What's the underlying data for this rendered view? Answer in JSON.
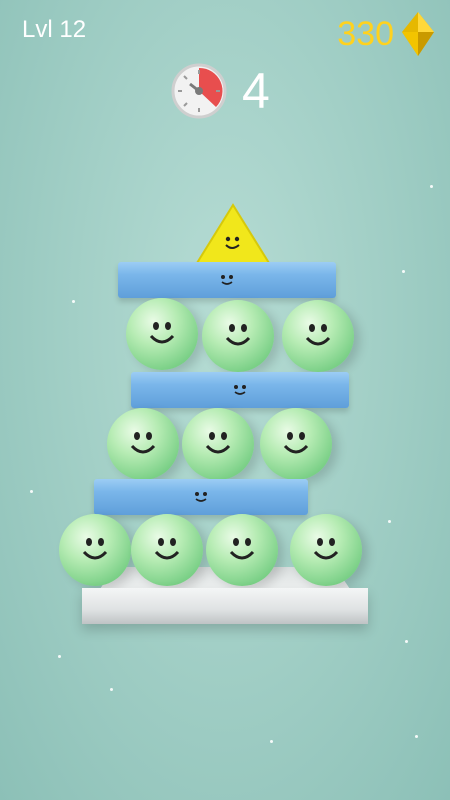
{
  "hud": {
    "level": "Lvl 12",
    "gems": "330",
    "timer": "4",
    "gem_color": "#ffd21e",
    "timer_icon": "stopwatch-icon",
    "gem_icon": "gem-icon"
  },
  "tower": {
    "top_piece": "yellow-triangle",
    "planks": 3,
    "balls_per_row": [
      3,
      3,
      4
    ],
    "ball_color": "#7bd087",
    "plank_color": "#7ab6ea",
    "base_color": "#dfe2e3"
  }
}
